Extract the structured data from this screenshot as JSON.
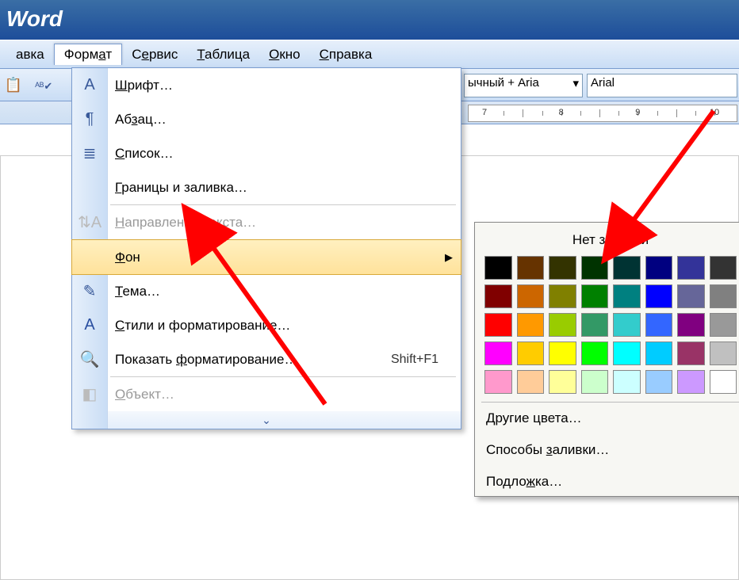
{
  "title": "Word",
  "menubar": {
    "items": [
      {
        "label": "авка",
        "u": ""
      },
      {
        "label": "Формат",
        "u": "а",
        "pre": "Форм",
        "post": "т",
        "active": true
      },
      {
        "label": "Сервис",
        "u": "е",
        "pre": "С",
        "post": "рвис"
      },
      {
        "label": "Таблица",
        "u": "Т",
        "pre": "",
        "post": "аблица"
      },
      {
        "label": "Окно",
        "u": "О",
        "pre": "",
        "post": "кно"
      },
      {
        "label": "Справка",
        "u": "С",
        "pre": "",
        "post": "правка"
      }
    ]
  },
  "combos": {
    "style": "ычный + Aria",
    "font": "Arial"
  },
  "dropdown": {
    "items": [
      {
        "icon": "A",
        "label": "Шрифт…",
        "u": "Ш",
        "pre": "",
        "post": "рифт…"
      },
      {
        "icon": "¶",
        "label": "Абзац…",
        "u": "з",
        "pre": "Аб",
        "post": "ац…"
      },
      {
        "icon": "≣",
        "label": "Список…",
        "u": "С",
        "pre": "",
        "post": "писок…"
      },
      {
        "icon": "",
        "label": "Границы и заливка…",
        "u": "Г",
        "pre": "",
        "post": "раницы и заливка…"
      },
      {
        "sep": true
      },
      {
        "icon": "⇅A",
        "label": "Направление текста…",
        "u": "Н",
        "pre": "",
        "post": "аправление текста…",
        "disabled": true
      },
      {
        "sep": true
      },
      {
        "icon": "",
        "label": "Фон",
        "u": "Ф",
        "pre": "",
        "post": "он",
        "highlight": true,
        "submenu": true
      },
      {
        "icon": "✎",
        "label": "Тема…",
        "u": "Т",
        "pre": "",
        "post": "ема…"
      },
      {
        "icon": "A",
        "label": "Стили и форматирование…",
        "u": "С",
        "pre": "",
        "post": "тили и форматирование…",
        "iconColor": "#2a4fa0"
      },
      {
        "icon": "🔍",
        "label": "Показать форматирование…",
        "u": "ф",
        "pre": "Показать ",
        "post": "орматирование…",
        "shortcut": "Shift+F1"
      },
      {
        "sep": true
      },
      {
        "icon": "◧",
        "label": "Объект…",
        "u": "О",
        "pre": "",
        "post": "бъект…",
        "disabled": true
      }
    ]
  },
  "submenu": {
    "title": "Нет заливки",
    "colors_row1": [
      "#000000",
      "#663300",
      "#333300",
      "#003300",
      "#003333",
      "#000080",
      "#333399",
      "#333333"
    ],
    "colors_row2": [
      "#800000",
      "#cc6600",
      "#808000",
      "#008000",
      "#008080",
      "#0000ff",
      "#666699",
      "#808080"
    ],
    "colors_row3": [
      "#ff0000",
      "#ff9900",
      "#99cc00",
      "#339966",
      "#33cccc",
      "#3366ff",
      "#800080",
      "#999999"
    ],
    "colors_row4": [
      "#ff00ff",
      "#ffcc00",
      "#ffff00",
      "#00ff00",
      "#00ffff",
      "#00ccff",
      "#993366",
      "#c0c0c0"
    ],
    "colors_row5": [
      "#ff99cc",
      "#ffcc99",
      "#ffff99",
      "#ccffcc",
      "#ccffff",
      "#99ccff",
      "#cc99ff",
      "#ffffff"
    ],
    "more": {
      "pre": "",
      "u": "Д",
      "post": "ругие цвета…"
    },
    "methods": {
      "pre": "Способы ",
      "u": "з",
      "post": "аливки…"
    },
    "watermark": {
      "pre": "Подло",
      "u": "ж",
      "post": "ка…"
    }
  },
  "ruler": {
    "numbers": [
      7,
      8,
      9,
      10
    ]
  }
}
